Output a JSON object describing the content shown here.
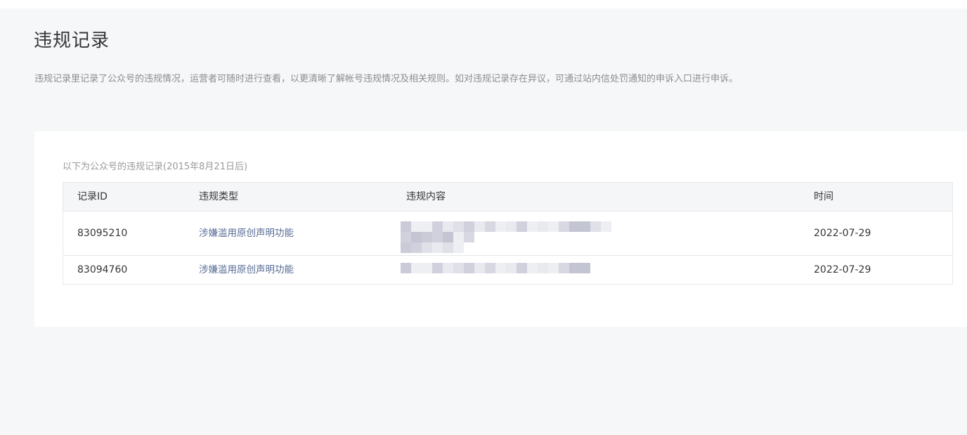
{
  "page": {
    "title": "违规记录",
    "description": "违规记录里记录了公众号的违规情况，运营者可随时进行查看，以更清晰了解帐号违规情况及相关规则。如对违规记录存在异议，可通过站内信处罚通知的申诉入口进行申诉。"
  },
  "records": {
    "caption": "以下为公众号的违规记录(2015年8月21日后)",
    "columns": [
      "记录ID",
      "违规类型",
      "违规内容",
      "时间"
    ],
    "rows": [
      {
        "id": "83095210",
        "type": "涉嫌滥用原创声明功能",
        "time": "2022-07-29"
      },
      {
        "id": "83094760",
        "type": "涉嫌滥用原创声明功能",
        "time": "2022-07-29"
      }
    ]
  },
  "colors": {
    "background": "#f6f7f9",
    "card": "#ffffff",
    "link": "#576b95",
    "border": "#e7e7eb",
    "header_bg": "#f5f6f8"
  }
}
